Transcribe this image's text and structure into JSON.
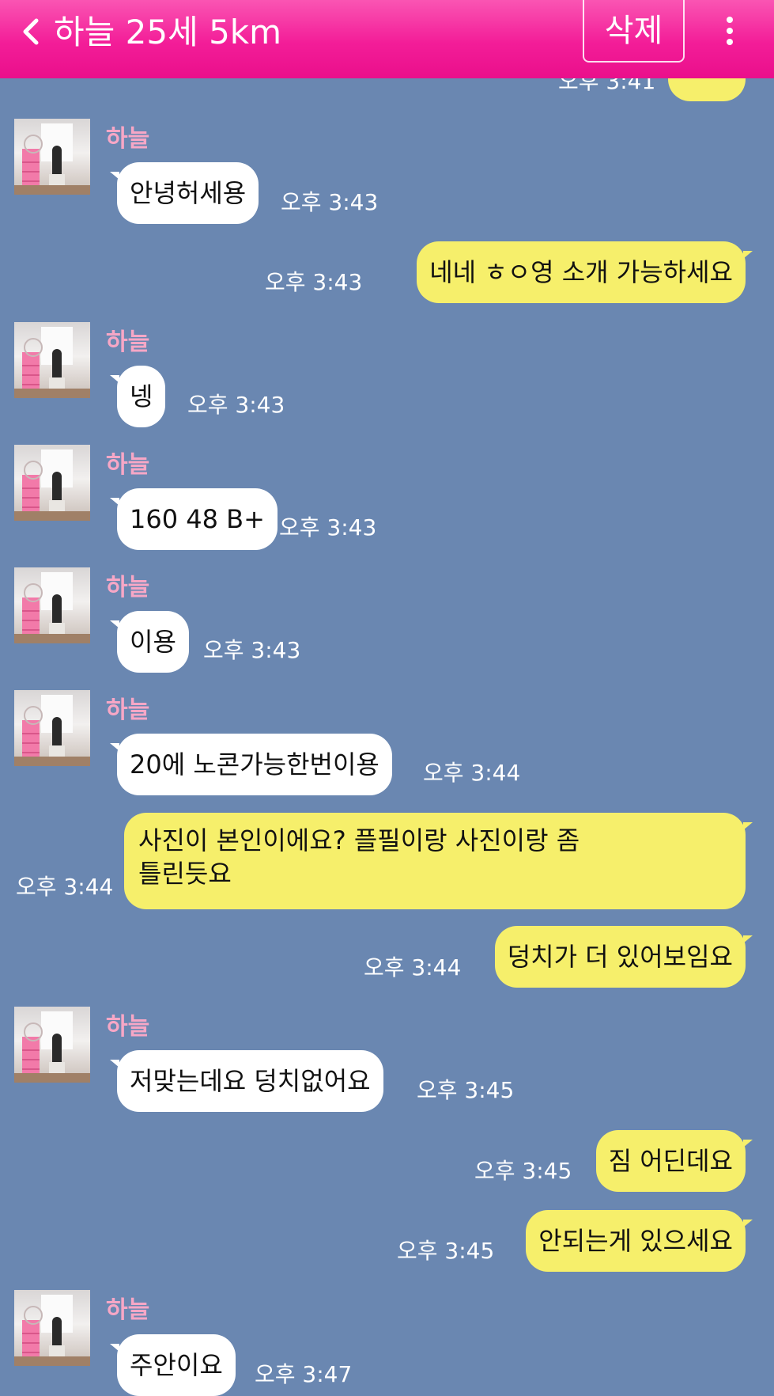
{
  "header": {
    "title": "하늘 25세 5km",
    "delete_label": "삭제"
  },
  "contact": {
    "name": "하늘"
  },
  "messages": [
    {
      "side": "out",
      "text": "",
      "time": "오후 3:41"
    },
    {
      "side": "in",
      "text": "안녕허세용",
      "time": "오후 3:43",
      "show_name": true
    },
    {
      "side": "out",
      "text": "네네  ㅎㅇ영  소개 가능하세요",
      "time": "오후 3:43"
    },
    {
      "side": "in",
      "text": "넹",
      "time": "오후 3:43",
      "show_name": true
    },
    {
      "side": "in",
      "text": "160 48 B+",
      "time": "오후 3:43",
      "show_name": true
    },
    {
      "side": "in",
      "text": "이용",
      "time": "오후 3:43",
      "show_name": true
    },
    {
      "side": "in",
      "text": "20에 노콘가능한번이용",
      "time": "오후 3:44",
      "show_name": true
    },
    {
      "side": "out",
      "text_line1": "사진이 본인이에요?  플필이랑 사진이랑 좀",
      "text_line2": "틀린듯요",
      "time": "오후 3:44"
    },
    {
      "side": "out",
      "text": "덩치가 더 있어보임요",
      "time": "오후 3:44"
    },
    {
      "side": "in",
      "text": "저맞는데요 덩치없어요",
      "time": "오후 3:45",
      "show_name": true
    },
    {
      "side": "out",
      "text": "짐 어딘데요",
      "time": "오후 3:45"
    },
    {
      "side": "out",
      "text": "안되는게 있으세요",
      "time": "오후 3:45"
    },
    {
      "side": "in",
      "text": "주안이요",
      "time": "오후 3:47",
      "show_name": true
    }
  ],
  "colors": {
    "header": "#f31d98",
    "background": "#6a87b1",
    "incoming_bubble": "#ffffff",
    "outgoing_bubble": "#f6ef6b",
    "name": "#f7a7c6"
  },
  "icons": {
    "back": "chevron-left-icon",
    "more": "more-vertical-icon"
  }
}
